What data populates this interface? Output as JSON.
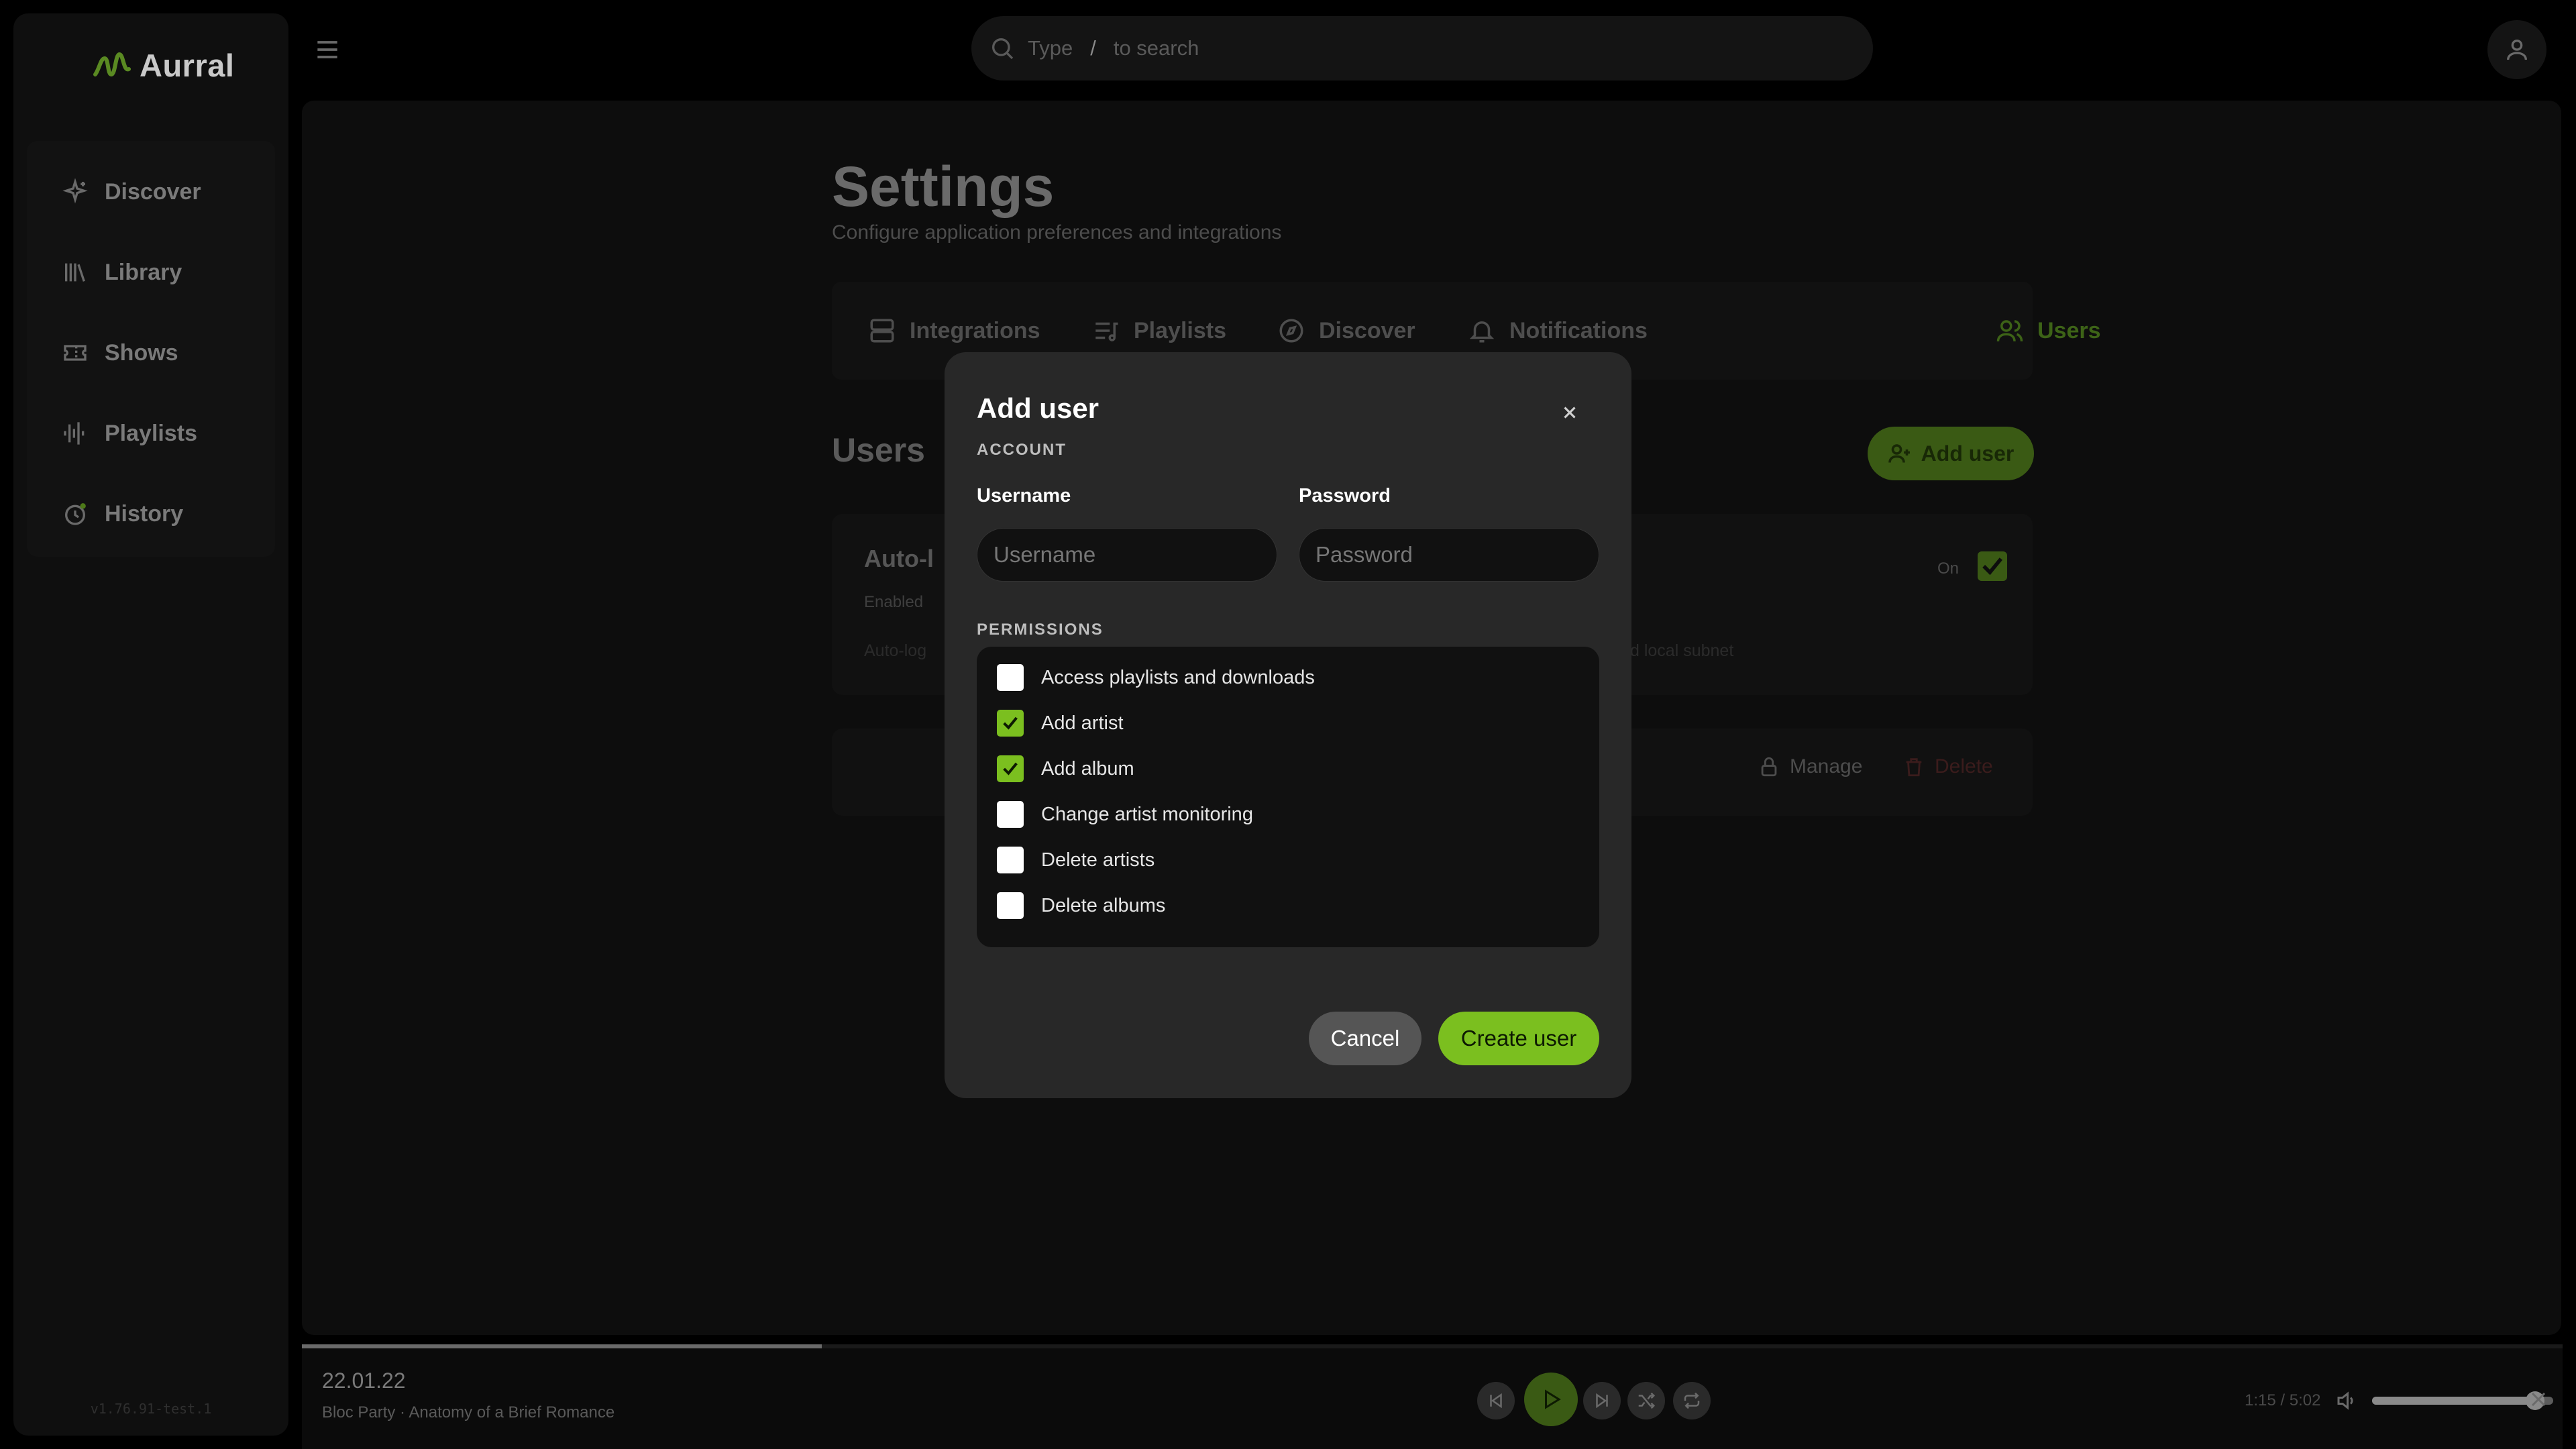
{
  "app": {
    "name": "Aurral",
    "version": "v1.76.91-test.1"
  },
  "colors": {
    "accent": "#7bbf1f",
    "accent_dim": "#3a5a14",
    "background": "#000000",
    "modal": "#282828"
  },
  "sidebar": {
    "items": [
      {
        "label": "Discover",
        "icon": "sparkle-icon"
      },
      {
        "label": "Library",
        "icon": "library-icon"
      },
      {
        "label": "Shows",
        "icon": "ticket-icon"
      },
      {
        "label": "Playlists",
        "icon": "playlist-wave-icon"
      },
      {
        "label": "History",
        "icon": "history-clock-icon"
      }
    ]
  },
  "search": {
    "prefix": "Type",
    "key": "/",
    "suffix": "to search"
  },
  "page": {
    "title": "Settings",
    "subtitle": "Configure application preferences and integrations",
    "tabs": [
      {
        "label": "Integrations",
        "icon": "server-icon"
      },
      {
        "label": "Playlists",
        "icon": "playlist-icon"
      },
      {
        "label": "Discover",
        "icon": "compass-icon"
      },
      {
        "label": "Notifications",
        "icon": "bell-icon"
      },
      {
        "label": "Users",
        "icon": "users-icon",
        "active": true
      }
    ],
    "users_heading": "Users",
    "add_user_label": "Add user",
    "auto_login": {
      "title": "Auto-l",
      "status": "Enabled",
      "description_start": "Auto-log",
      "description_end": "d local subnet",
      "toggle_label": "On",
      "checked": true
    },
    "user_actions": {
      "manage": "Manage",
      "delete": "Delete"
    }
  },
  "modal": {
    "title": "Add user",
    "account_section": "ACCOUNT",
    "username_label": "Username",
    "username_placeholder": "Username",
    "password_label": "Password",
    "password_placeholder": "Password",
    "permissions_section": "PERMISSIONS",
    "permissions": [
      {
        "label": "Access playlists and downloads",
        "checked": false
      },
      {
        "label": "Add artist",
        "checked": true
      },
      {
        "label": "Add album",
        "checked": true
      },
      {
        "label": "Change artist monitoring",
        "checked": false
      },
      {
        "label": "Delete artists",
        "checked": false
      },
      {
        "label": "Delete albums",
        "checked": false
      }
    ],
    "cancel_label": "Cancel",
    "create_label": "Create user"
  },
  "player": {
    "track_title": "22.01.22",
    "track_artist": "Bloc Party · Anatomy of a Brief Romance",
    "time": "1:15 / 5:02",
    "progress": 0.23,
    "volume": 0.9
  }
}
